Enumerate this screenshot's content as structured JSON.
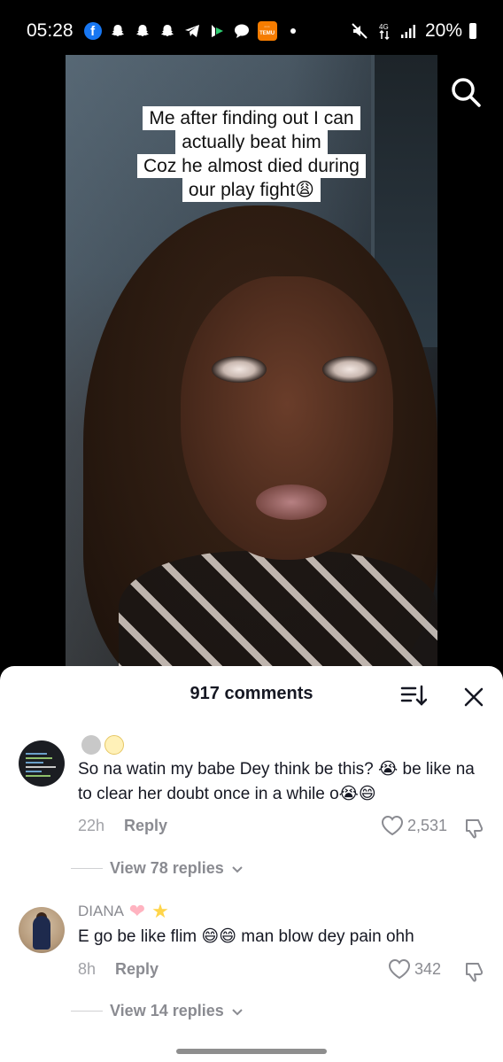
{
  "status_bar": {
    "time": "05:28",
    "battery": "20%"
  },
  "video": {
    "caption_lines": [
      "Me after finding out I can",
      "actually beat him",
      "Coz he almost died during",
      "our play fight😩"
    ]
  },
  "comments_sheet": {
    "title": "917 comments",
    "comments": [
      {
        "username": "",
        "text": "So na watin my babe Dey think be this? 😭 be like na to clear her doubt once in a while o😭😄",
        "time": "22h",
        "reply_label": "Reply",
        "likes": "2,531",
        "view_replies": "View 78 replies"
      },
      {
        "username": "DIANA",
        "text": "E go be like flim 😄😄 man blow dey pain ohh",
        "time": "8h",
        "reply_label": "Reply",
        "likes": "342",
        "view_replies": "View 14 replies"
      }
    ]
  },
  "icons": {
    "status": [
      "facebook-icon",
      "snapchat-icon",
      "snapchat-icon",
      "snapchat-icon",
      "telegram-icon",
      "play-icon",
      "message-icon",
      "temu-icon",
      "dot-icon",
      "mute-icon",
      "data-icon",
      "signal-icon",
      "battery-icon"
    ],
    "video": [
      "search-icon"
    ],
    "sheet": [
      "sort-icon",
      "close-icon",
      "heart-icon",
      "dislike-icon",
      "chevron-down-icon"
    ]
  },
  "colors": {
    "sheet_bg": "#ffffff",
    "text_primary": "#161823",
    "text_secondary": "#8a8b91"
  }
}
